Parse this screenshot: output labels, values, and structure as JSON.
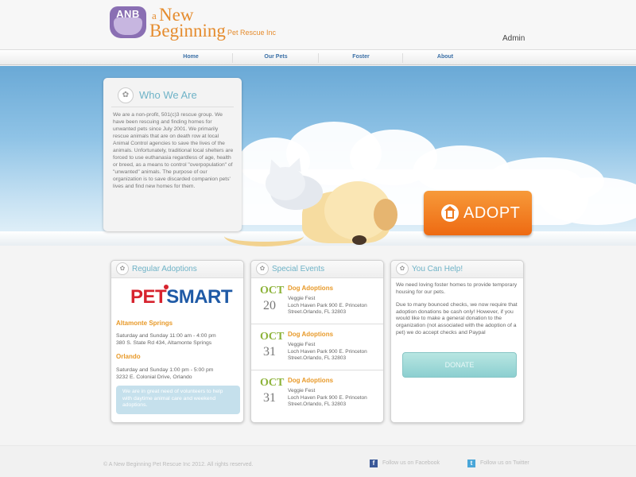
{
  "header": {
    "logo_badge": "ANB",
    "logo_a": "a",
    "logo_new": "New",
    "logo_beginning": "Beginning",
    "logo_sub": "Pet Rescue Inc",
    "admin_label": "Admin"
  },
  "nav": {
    "items": [
      {
        "label": "Home"
      },
      {
        "label": "Our Pets"
      },
      {
        "label": "Foster"
      },
      {
        "label": "About"
      }
    ]
  },
  "hero": {
    "who_title": "Who We Are",
    "who_text": "We are a non-profit, 501(c)3 rescue group. We have been rescuing and finding homes for unwanted pets since July 2001. We primarily rescue animals that are on death row at local Animal Control agencies to save the lives of the animals. Unfortunately, traditional local shelters are forced to use euthanasia regardless of age, health or breed, as a means to control \"overpopulation\" of \"unwanted\" animals. The purpose of our organization is to save discarded companion pets' lives and find new homes for them.",
    "adopt_label": "ADOPT"
  },
  "regular": {
    "title": "Regular Adoptions",
    "logo_pet": "PET",
    "logo_smart": "SMART",
    "locations": [
      {
        "name": "Altamonte Springs",
        "line1": "Saturday and Sunday 11:00 am - 4:00 pm",
        "line2": "380 S. State Rd 434, Altamonte Springs"
      },
      {
        "name": "Orlando",
        "line1": "Saturday and Sunday 1:00 pm - 5:00 pm",
        "line2": "3232 E. Colonial Drive, Orlando"
      }
    ],
    "volunteer": "We are in great need of volunteers to help with daytime animal care and weekend adoptions."
  },
  "events": {
    "title": "Special Events",
    "items": [
      {
        "month": "OCT",
        "day": "20",
        "title": "Dog Adoptions",
        "line1": "Veggie Fest",
        "line2": "Loch Haven Park 900 E. Princeton",
        "line3": "Street.Orlando, FL 32803"
      },
      {
        "month": "OCT",
        "day": "31",
        "title": "Dog Adoptions",
        "line1": "Veggie Fest",
        "line2": "Loch Haven Park 900 E. Princeton",
        "line3": "Street.Orlando, FL 32803"
      },
      {
        "month": "OCT",
        "day": "31",
        "title": "Dog Adoptions",
        "line1": "Veggie Fest",
        "line2": "Loch Haven Park 900 E. Princeton",
        "line3": "Street.Orlando, FL 32803"
      }
    ]
  },
  "help": {
    "title": "You Can Help!",
    "text1": "We need loving foster homes to provide temporary housing for our pets.",
    "text2": "Due to many bounced checks, we now require that adoption donations be cash only! However, if you would like to make a general donation to the organization (not associated with the adoption of a pet) we do accept checks and Paypal",
    "donate_label": "DONATE"
  },
  "footer": {
    "copyright": "© A New Beginning Pet Rescue Inc 2012. All rights reserved.",
    "facebook": "Follow us on Facebook",
    "twitter": "Follow us on Twitter"
  },
  "colors": {
    "accent_orange": "#ee6a12",
    "title_teal": "#6fb3c7",
    "event_green": "#8db33a",
    "nav_blue": "#3a6fa6"
  }
}
